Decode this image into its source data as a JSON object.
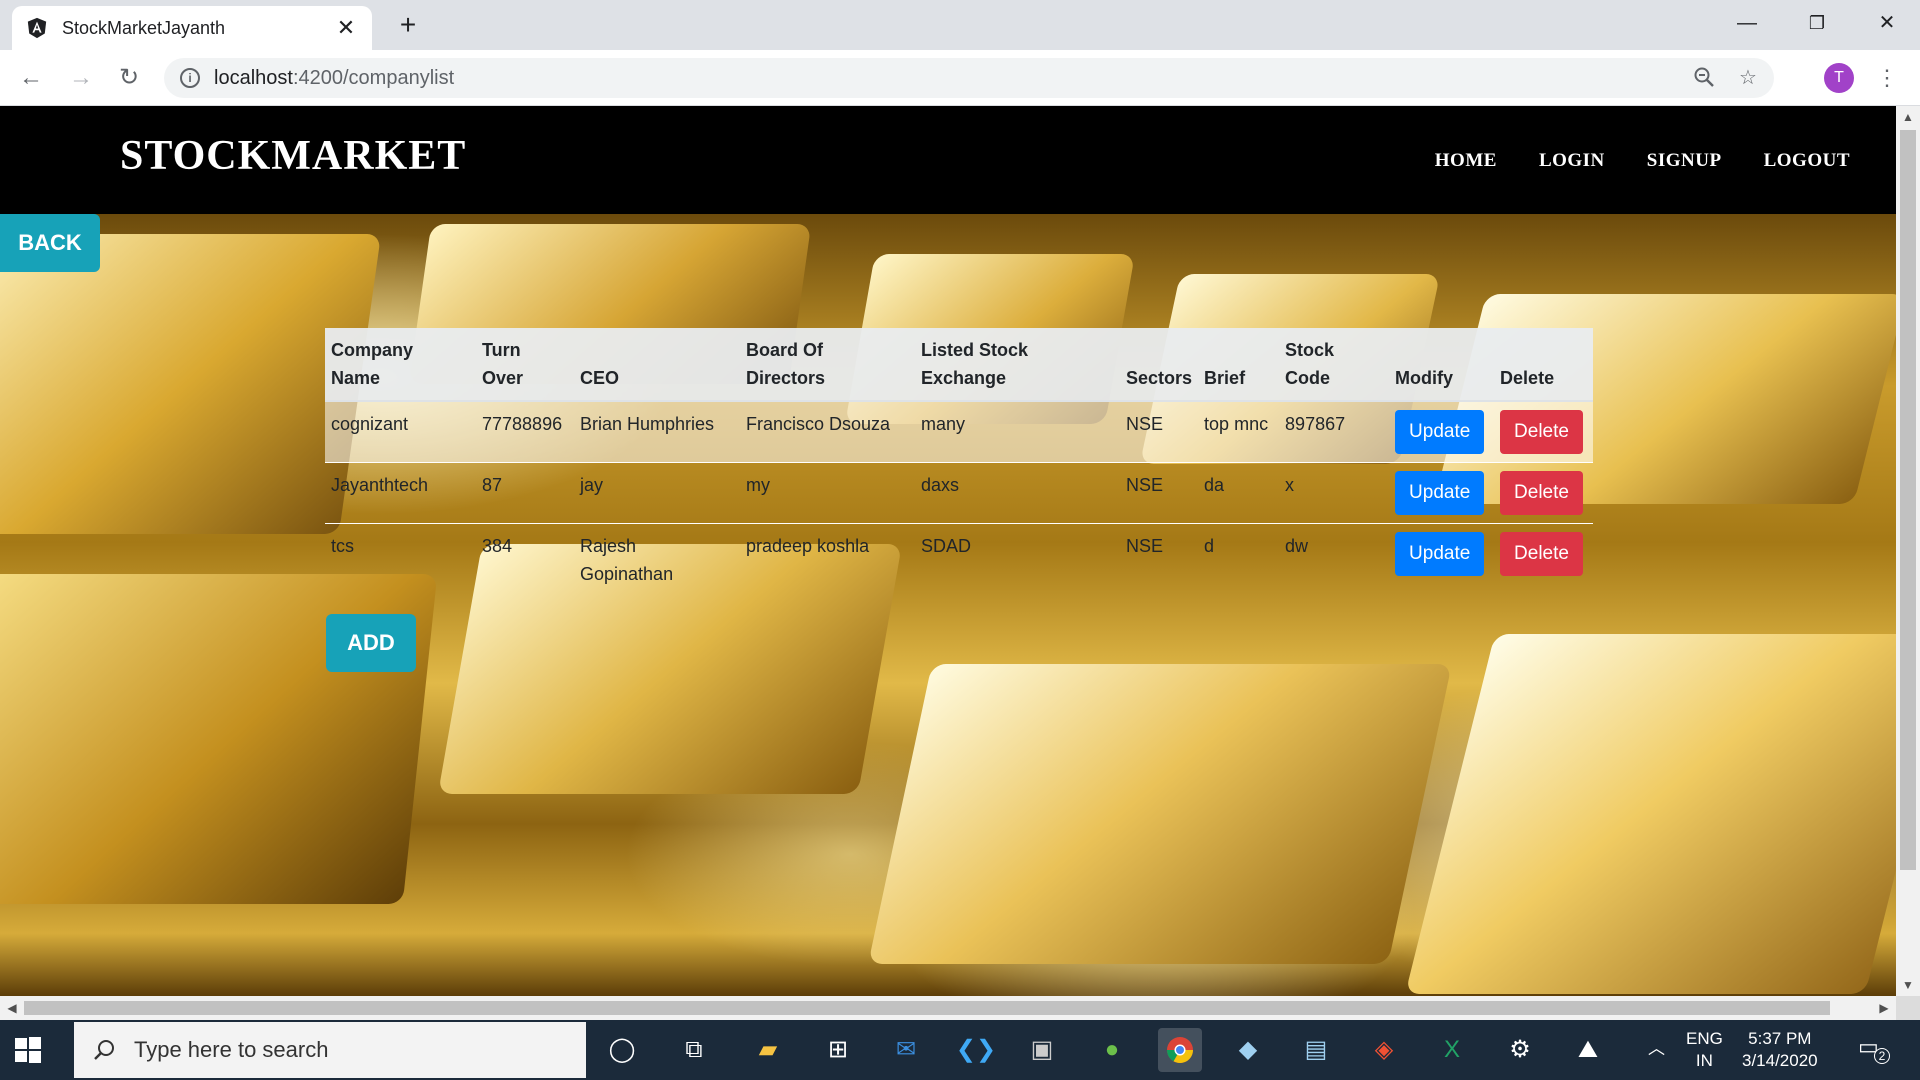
{
  "browser": {
    "tab_title": "StockMarketJayanth",
    "url_host": "localhost",
    "url_path": ":4200/companylist",
    "profile_initial": "T"
  },
  "navbar": {
    "brand": "STOCKMARKET",
    "links": [
      "HOME",
      "LOGIN",
      "SIGNUP",
      "LOGOUT"
    ]
  },
  "page": {
    "back_label": "BACK",
    "add_label": "ADD"
  },
  "table": {
    "headers": [
      [
        "Company",
        "Name"
      ],
      [
        "Turn",
        "Over"
      ],
      [
        "",
        "CEO"
      ],
      [
        "Board Of",
        "Directors"
      ],
      [
        "Listed Stock",
        "Exchange"
      ],
      [
        "",
        "Sectors"
      ],
      [
        "",
        "Brief"
      ],
      [
        "Stock",
        "Code"
      ],
      [
        "",
        "Modify"
      ],
      [
        "",
        "Delete"
      ]
    ],
    "rows": [
      {
        "company_name": "cognizant",
        "turnover": "77788896",
        "ceo": "Brian Humphries",
        "board": "Francisco Dsouza",
        "exchange": "many",
        "sectors": "NSE",
        "brief": "top mnc",
        "stock_code": "897867",
        "update_label": "Update",
        "delete_label": "Delete"
      },
      {
        "company_name": "Jayanthtech",
        "turnover": "87",
        "ceo": "jay",
        "board": "my",
        "exchange": "daxs",
        "sectors": "NSE",
        "brief": "da",
        "stock_code": "x",
        "update_label": "Update",
        "delete_label": "Delete"
      },
      {
        "company_name": "tcs",
        "turnover": "384",
        "ceo": "Rajesh Gopinathan",
        "board": "pradeep koshla",
        "exchange": "SDAD",
        "sectors": "NSE",
        "brief": "d",
        "stock_code": "dw",
        "update_label": "Update",
        "delete_label": "Delete"
      }
    ]
  },
  "taskbar": {
    "search_placeholder": "Type here to search",
    "lang": "ENG",
    "region": "IN",
    "time": "5:37 PM",
    "date": "3/14/2020",
    "notification_count": "2"
  },
  "colors": {
    "info_button": "#17a2b8",
    "update_button": "#007bff",
    "delete_button": "#dc3545",
    "navbar": "#000000"
  }
}
